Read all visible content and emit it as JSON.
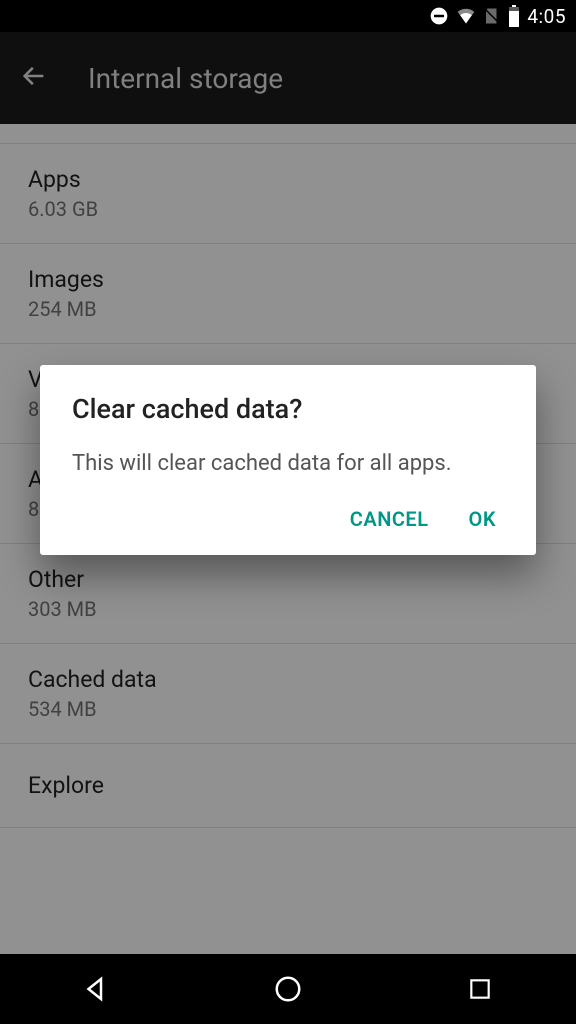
{
  "statusbar": {
    "time": "4:05"
  },
  "appbar": {
    "title": "Internal storage"
  },
  "storage": {
    "items": [
      {
        "label": "Apps",
        "sub": "6.03 GB"
      },
      {
        "label": "Images",
        "sub": "254 MB"
      },
      {
        "label": "V",
        "sub": "8"
      },
      {
        "label": "A",
        "sub": "8"
      },
      {
        "label": "Other",
        "sub": "303 MB"
      },
      {
        "label": "Cached data",
        "sub": "534 MB"
      },
      {
        "label": "Explore",
        "sub": ""
      }
    ]
  },
  "dialog": {
    "title": "Clear cached data?",
    "message": "This will clear cached data for all apps.",
    "cancel": "CANCEL",
    "ok": "OK"
  },
  "colors": {
    "accent": "#009688"
  }
}
